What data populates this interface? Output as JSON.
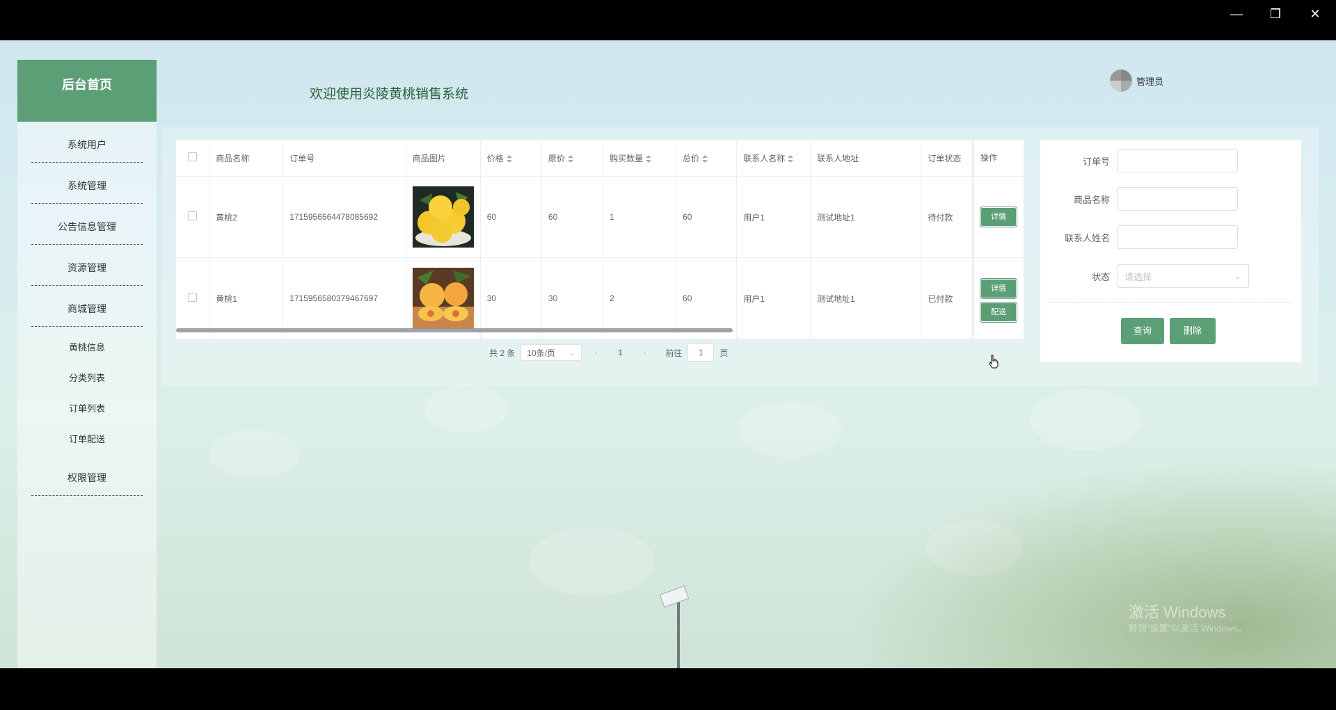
{
  "window": {
    "minimize": "—",
    "restore": "❐",
    "close": "✕"
  },
  "sidebar": {
    "brand": "后台首页",
    "items": [
      {
        "label": "系统用户"
      },
      {
        "label": "系统管理"
      },
      {
        "label": "公告信息管理"
      },
      {
        "label": "资源管理"
      },
      {
        "label": "商城管理"
      }
    ],
    "subitems": [
      {
        "label": "黄桃信息"
      },
      {
        "label": "分类列表"
      },
      {
        "label": "订单列表"
      },
      {
        "label": "订单配送"
      }
    ],
    "last": {
      "label": "权限管理"
    }
  },
  "header": {
    "welcome": "欢迎使用炎陵黄桃销售系统",
    "user": "管理员"
  },
  "table": {
    "columns": [
      "商品名称",
      "订单号",
      "商品图片",
      "价格",
      "原价",
      "购买数量",
      "总价",
      "联系人名称",
      "联系人地址",
      "订单状态",
      "操作"
    ],
    "rows": [
      {
        "name": "黄桃2",
        "order_no": "1715956564478085692",
        "price": "60",
        "orig": "60",
        "qty": "1",
        "total": "60",
        "contact": "用户1",
        "address": "测试地址1",
        "status": "待付款",
        "actions": [
          "详情"
        ]
      },
      {
        "name": "黄桃1",
        "order_no": "1715956580379467697",
        "price": "30",
        "orig": "30",
        "qty": "2",
        "total": "60",
        "contact": "用户1",
        "address": "测试地址1",
        "status": "已付款",
        "actions": [
          "详情",
          "配送"
        ]
      }
    ]
  },
  "pagination": {
    "total": "共 2 条",
    "page_size": "10条/页",
    "current": "1",
    "goto_label": "前往",
    "goto_value": "1",
    "page_unit": "页",
    "prev": "‹",
    "next": "›"
  },
  "search": {
    "order_no_label": "订单号",
    "product_label": "商品名称",
    "contact_label": "联系人姓名",
    "status_label": "状态",
    "status_placeholder": "请选择",
    "query_button": "查询",
    "delete_button": "删除"
  },
  "watermark": {
    "line1": "激活 Windows",
    "line2": "转到\"设置\"以激活 Windows。"
  },
  "colors": {
    "accent": "#5c9e76",
    "title": "#2e5f3a"
  }
}
